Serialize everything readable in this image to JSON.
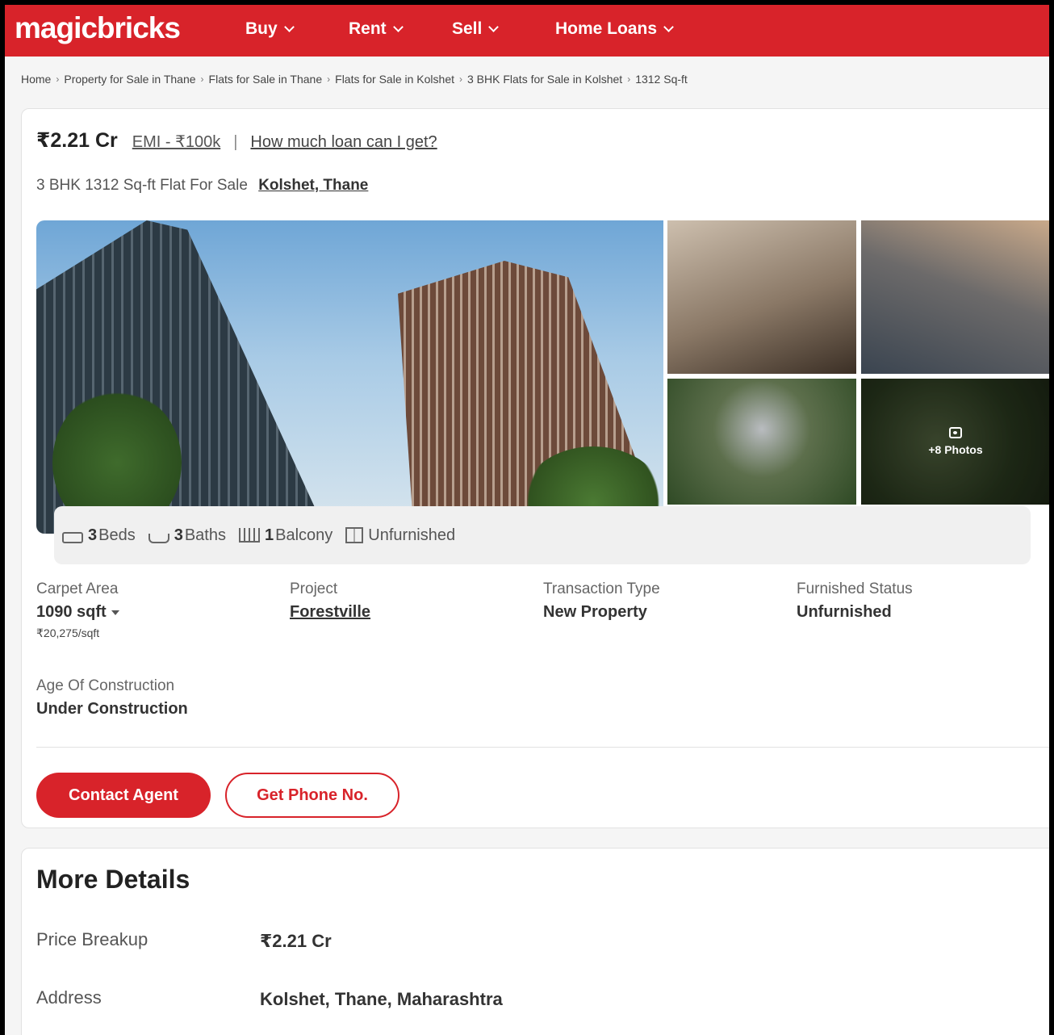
{
  "header": {
    "logo": "magicbricks",
    "nav": [
      "Buy",
      "Rent",
      "Sell",
      "Home Loans"
    ]
  },
  "breadcrumb": [
    "Home",
    "Property for Sale in Thane",
    "Flats for Sale in Thane",
    "Flats for Sale in Kolshet",
    "3 BHK Flats for Sale in Kolshet",
    "1312 Sq-ft"
  ],
  "listing": {
    "price": "₹2.21 Cr",
    "emi": "EMI - ₹100k",
    "separator": "|",
    "loan_link": "How much loan can I get?",
    "subtitle": "3 BHK 1312 Sq-ft Flat For Sale",
    "location": "Kolshet, Thane",
    "photos_more": "+8 Photos",
    "amenities": {
      "beds_count": "3",
      "beds_label": "Beds",
      "baths_count": "3",
      "baths_label": "Baths",
      "balcony_count": "1",
      "balcony_label": "Balcony",
      "furnishing": "Unfurnished"
    },
    "specs": {
      "carpet_area_label": "Carpet Area",
      "carpet_area_value": "1090 sqft",
      "price_per_sqft": "₹20,275/sqft",
      "project_label": "Project",
      "project_value": "Forestville",
      "transaction_label": "Transaction Type",
      "transaction_value": "New Property",
      "furnished_label": "Furnished Status",
      "furnished_value": "Unfurnished",
      "age_label": "Age Of Construction",
      "age_value": "Under Construction"
    },
    "buttons": {
      "contact": "Contact Agent",
      "phone": "Get Phone No."
    }
  },
  "more_details": {
    "title": "More Details",
    "rows": [
      {
        "label": "Price Breakup",
        "value": "₹2.21 Cr"
      },
      {
        "label": "Address",
        "value": "Kolshet, Thane, Maharashtra"
      }
    ]
  },
  "colors": {
    "brand": "#d8232a"
  }
}
